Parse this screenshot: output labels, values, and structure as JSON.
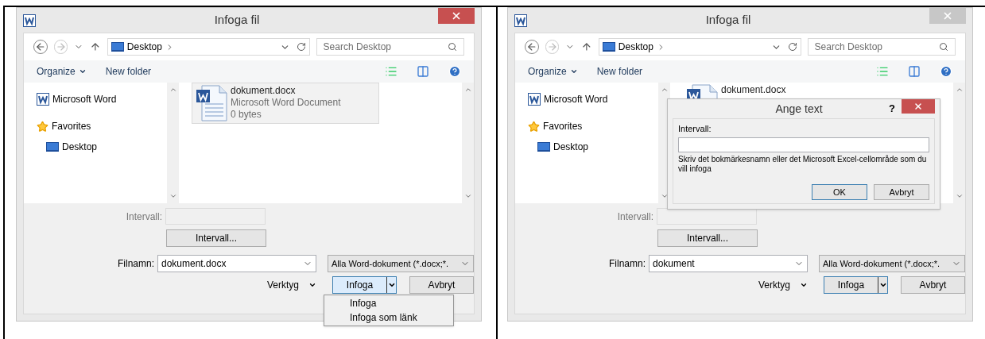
{
  "panels": [
    {
      "window": {
        "title": "Infoga fil",
        "active": true
      },
      "address": "Desktop",
      "search": {
        "placeholder": "Search Desktop"
      },
      "toolbar": {
        "organize": "Organize",
        "new_folder": "New folder"
      },
      "nav_items": [
        {
          "kind": "app",
          "label": "Microsoft Word"
        },
        {
          "kind": "favorites",
          "label": "Favorites",
          "children": [
            {
              "label": "Desktop"
            }
          ]
        }
      ],
      "file": {
        "name": "dokument.docx",
        "type": "Microsoft Word Document",
        "size": "0 bytes"
      },
      "range": {
        "label": "Intervall:",
        "button": "Intervall..."
      },
      "filename": {
        "label": "Filnamn:",
        "value": "dokument.docx"
      },
      "filter": "Alla Word-dokument (*.docx;*.",
      "tools": "Verktyg",
      "insert": "Infoga",
      "cancel": "Avbryt",
      "menu": {
        "items": [
          "Infoga",
          "Infoga som länk"
        ]
      }
    },
    {
      "window": {
        "title": "Infoga fil",
        "active": false
      },
      "address": "Desktop",
      "search": {
        "placeholder": "Search Desktop"
      },
      "toolbar": {
        "organize": "Organize",
        "new_folder": "New folder"
      },
      "nav_items": [
        {
          "kind": "app",
          "label": "Microsoft Word"
        },
        {
          "kind": "favorites",
          "label": "Favorites",
          "children": [
            {
              "label": "Desktop"
            }
          ]
        }
      ],
      "file": {
        "name": "dokument.docx"
      },
      "range": {
        "label": "Intervall:",
        "button": "Intervall..."
      },
      "filename": {
        "label": "Filnamn:",
        "value": "dokument"
      },
      "filter": "Alla Word-dokument (*.docx;*.",
      "tools": "Verktyg",
      "insert": "Infoga",
      "cancel": "Avbryt",
      "dialog": {
        "title": "Ange text",
        "help": "?",
        "label": "Intervall:",
        "hint": "Skriv det bokmärkesnamn eller det Microsoft Excel-cellområde som du vill infoga",
        "ok": "OK",
        "cancel": "Avbryt"
      }
    }
  ]
}
